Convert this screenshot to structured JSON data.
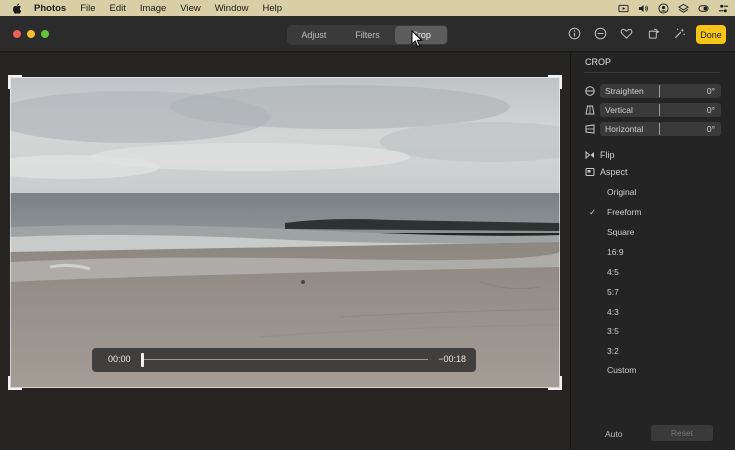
{
  "menubar": {
    "app_name": "Photos",
    "items": [
      "File",
      "Edit",
      "Image",
      "View",
      "Window",
      "Help"
    ]
  },
  "toolbar": {
    "tabs": [
      {
        "label": "Adjust",
        "active": false
      },
      {
        "label": "Filters",
        "active": false
      },
      {
        "label": "Crop",
        "active": true
      }
    ],
    "done_label": "Done"
  },
  "video": {
    "current_time": "00:00",
    "remaining_time": "−00:18"
  },
  "sidebar": {
    "title": "CROP",
    "sliders": [
      {
        "label": "Straighten",
        "value": "0°"
      },
      {
        "label": "Vertical",
        "value": "0°"
      },
      {
        "label": "Horizontal",
        "value": "0°"
      }
    ],
    "flip_label": "Flip",
    "aspect_label": "Aspect",
    "aspect_options": [
      "Original",
      "Freeform",
      "Square",
      "16:9",
      "4:5",
      "5:7",
      "4:3",
      "3:5",
      "3:2",
      "Custom"
    ],
    "selected_aspect": "Freeform",
    "auto_label": "Auto",
    "reset_label": "Reset"
  },
  "colors": {
    "accent_done": "#f5c518",
    "menubar_bg": "#d9cfa6"
  }
}
